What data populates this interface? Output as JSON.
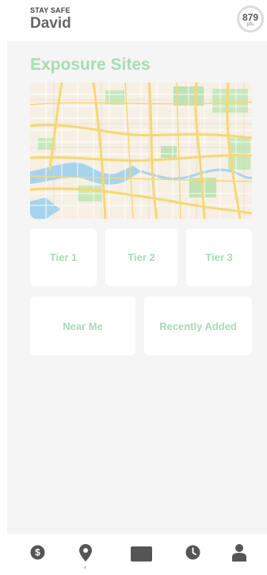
{
  "header": {
    "app_label": "STAY SAFE",
    "user_name": "David",
    "points": {
      "value": "879",
      "unit": "pts"
    }
  },
  "main": {
    "title": "Exposure Sites",
    "tiles": [
      {
        "label": "Tier 1"
      },
      {
        "label": "Tier 2"
      },
      {
        "label": "Tier 3"
      },
      {
        "label": "Near Me"
      },
      {
        "label": "Recently Added"
      }
    ]
  },
  "nav": {
    "items": [
      {
        "icon": "dollar-icon"
      },
      {
        "icon": "location-pin-icon",
        "active": true
      },
      {
        "icon": "card-icon"
      },
      {
        "icon": "clock-icon"
      },
      {
        "icon": "person-icon"
      }
    ]
  },
  "colors": {
    "accent": "#a6dcb0",
    "background": "#f5f5f5",
    "icon": "#555555"
  }
}
